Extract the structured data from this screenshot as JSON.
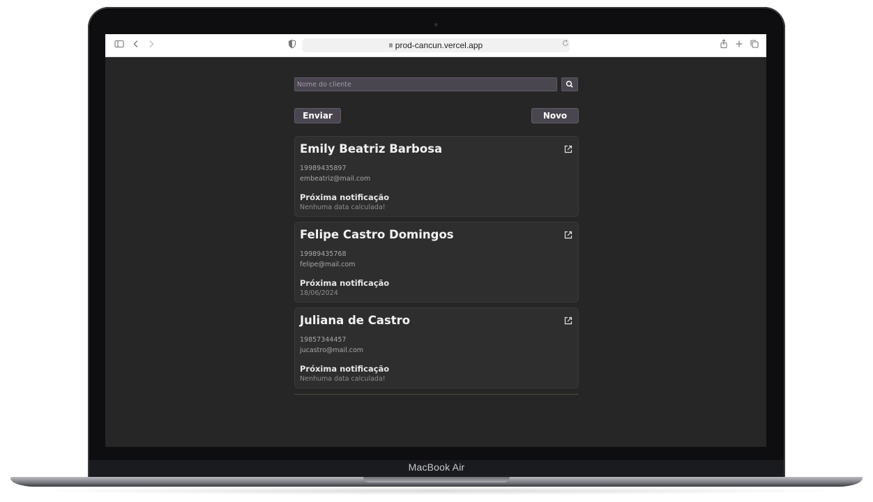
{
  "browser": {
    "url": "prod-cancun.vercel.app",
    "icons": [
      "sidebar-icon",
      "back-icon",
      "forward-icon",
      "privacy-shield-icon",
      "reload-icon",
      "share-icon",
      "new-tab-icon",
      "tabs-overview-icon"
    ]
  },
  "device": {
    "label": "MacBook Air"
  },
  "search": {
    "placeholder": "Nome do cliente",
    "button_icon": "search-icon"
  },
  "actions": {
    "send_label": "Enviar",
    "new_label": "Novo"
  },
  "clients": [
    {
      "name": "Emily Beatriz Barbosa",
      "phone": "19989435897",
      "email": "embeatriz@mail.com",
      "notification_label": "Próxima notificação",
      "notification_value": "Nenhuma data calculada!"
    },
    {
      "name": "Felipe Castro Domingos",
      "phone": "19989435768",
      "email": "felipe@mail.com",
      "notification_label": "Próxima notificação",
      "notification_value": "18/06/2024"
    },
    {
      "name": "Juliana de Castro",
      "phone": "19857344457",
      "email": "jucastro@mail.com",
      "notification_label": "Próxima notificação",
      "notification_value": "Nenhuma data calculada!"
    }
  ],
  "colors": {
    "app_background": "#262626",
    "card_background": "#2e2e2e",
    "button_background": "#4a4650"
  }
}
